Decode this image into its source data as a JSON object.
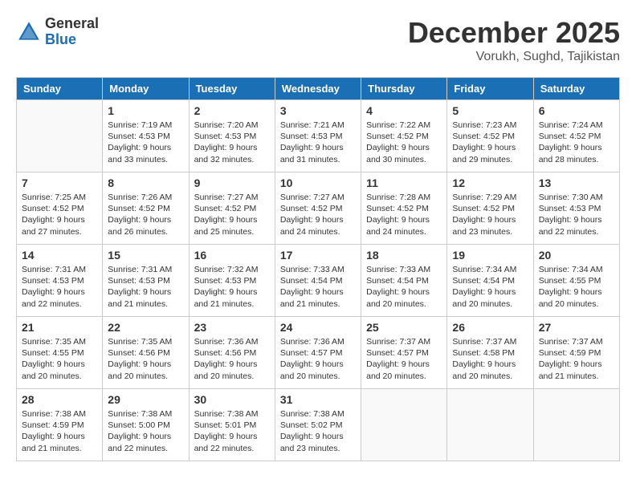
{
  "header": {
    "logo": {
      "general": "General",
      "blue": "Blue"
    },
    "month_year": "December 2025",
    "location": "Vorukh, Sughd, Tajikistan"
  },
  "days_of_week": [
    "Sunday",
    "Monday",
    "Tuesday",
    "Wednesday",
    "Thursday",
    "Friday",
    "Saturday"
  ],
  "weeks": [
    [
      {
        "day": "",
        "info": ""
      },
      {
        "day": "1",
        "info": "Sunrise: 7:19 AM\nSunset: 4:53 PM\nDaylight: 9 hours\nand 33 minutes."
      },
      {
        "day": "2",
        "info": "Sunrise: 7:20 AM\nSunset: 4:53 PM\nDaylight: 9 hours\nand 32 minutes."
      },
      {
        "day": "3",
        "info": "Sunrise: 7:21 AM\nSunset: 4:53 PM\nDaylight: 9 hours\nand 31 minutes."
      },
      {
        "day": "4",
        "info": "Sunrise: 7:22 AM\nSunset: 4:52 PM\nDaylight: 9 hours\nand 30 minutes."
      },
      {
        "day": "5",
        "info": "Sunrise: 7:23 AM\nSunset: 4:52 PM\nDaylight: 9 hours\nand 29 minutes."
      },
      {
        "day": "6",
        "info": "Sunrise: 7:24 AM\nSunset: 4:52 PM\nDaylight: 9 hours\nand 28 minutes."
      }
    ],
    [
      {
        "day": "7",
        "info": "Sunrise: 7:25 AM\nSunset: 4:52 PM\nDaylight: 9 hours\nand 27 minutes."
      },
      {
        "day": "8",
        "info": "Sunrise: 7:26 AM\nSunset: 4:52 PM\nDaylight: 9 hours\nand 26 minutes."
      },
      {
        "day": "9",
        "info": "Sunrise: 7:27 AM\nSunset: 4:52 PM\nDaylight: 9 hours\nand 25 minutes."
      },
      {
        "day": "10",
        "info": "Sunrise: 7:27 AM\nSunset: 4:52 PM\nDaylight: 9 hours\nand 24 minutes."
      },
      {
        "day": "11",
        "info": "Sunrise: 7:28 AM\nSunset: 4:52 PM\nDaylight: 9 hours\nand 24 minutes."
      },
      {
        "day": "12",
        "info": "Sunrise: 7:29 AM\nSunset: 4:52 PM\nDaylight: 9 hours\nand 23 minutes."
      },
      {
        "day": "13",
        "info": "Sunrise: 7:30 AM\nSunset: 4:53 PM\nDaylight: 9 hours\nand 22 minutes."
      }
    ],
    [
      {
        "day": "14",
        "info": "Sunrise: 7:31 AM\nSunset: 4:53 PM\nDaylight: 9 hours\nand 22 minutes."
      },
      {
        "day": "15",
        "info": "Sunrise: 7:31 AM\nSunset: 4:53 PM\nDaylight: 9 hours\nand 21 minutes."
      },
      {
        "day": "16",
        "info": "Sunrise: 7:32 AM\nSunset: 4:53 PM\nDaylight: 9 hours\nand 21 minutes."
      },
      {
        "day": "17",
        "info": "Sunrise: 7:33 AM\nSunset: 4:54 PM\nDaylight: 9 hours\nand 21 minutes."
      },
      {
        "day": "18",
        "info": "Sunrise: 7:33 AM\nSunset: 4:54 PM\nDaylight: 9 hours\nand 20 minutes."
      },
      {
        "day": "19",
        "info": "Sunrise: 7:34 AM\nSunset: 4:54 PM\nDaylight: 9 hours\nand 20 minutes."
      },
      {
        "day": "20",
        "info": "Sunrise: 7:34 AM\nSunset: 4:55 PM\nDaylight: 9 hours\nand 20 minutes."
      }
    ],
    [
      {
        "day": "21",
        "info": "Sunrise: 7:35 AM\nSunset: 4:55 PM\nDaylight: 9 hours\nand 20 minutes."
      },
      {
        "day": "22",
        "info": "Sunrise: 7:35 AM\nSunset: 4:56 PM\nDaylight: 9 hours\nand 20 minutes."
      },
      {
        "day": "23",
        "info": "Sunrise: 7:36 AM\nSunset: 4:56 PM\nDaylight: 9 hours\nand 20 minutes."
      },
      {
        "day": "24",
        "info": "Sunrise: 7:36 AM\nSunset: 4:57 PM\nDaylight: 9 hours\nand 20 minutes."
      },
      {
        "day": "25",
        "info": "Sunrise: 7:37 AM\nSunset: 4:57 PM\nDaylight: 9 hours\nand 20 minutes."
      },
      {
        "day": "26",
        "info": "Sunrise: 7:37 AM\nSunset: 4:58 PM\nDaylight: 9 hours\nand 20 minutes."
      },
      {
        "day": "27",
        "info": "Sunrise: 7:37 AM\nSunset: 4:59 PM\nDaylight: 9 hours\nand 21 minutes."
      }
    ],
    [
      {
        "day": "28",
        "info": "Sunrise: 7:38 AM\nSunset: 4:59 PM\nDaylight: 9 hours\nand 21 minutes."
      },
      {
        "day": "29",
        "info": "Sunrise: 7:38 AM\nSunset: 5:00 PM\nDaylight: 9 hours\nand 22 minutes."
      },
      {
        "day": "30",
        "info": "Sunrise: 7:38 AM\nSunset: 5:01 PM\nDaylight: 9 hours\nand 22 minutes."
      },
      {
        "day": "31",
        "info": "Sunrise: 7:38 AM\nSunset: 5:02 PM\nDaylight: 9 hours\nand 23 minutes."
      },
      {
        "day": "",
        "info": ""
      },
      {
        "day": "",
        "info": ""
      },
      {
        "day": "",
        "info": ""
      }
    ]
  ]
}
